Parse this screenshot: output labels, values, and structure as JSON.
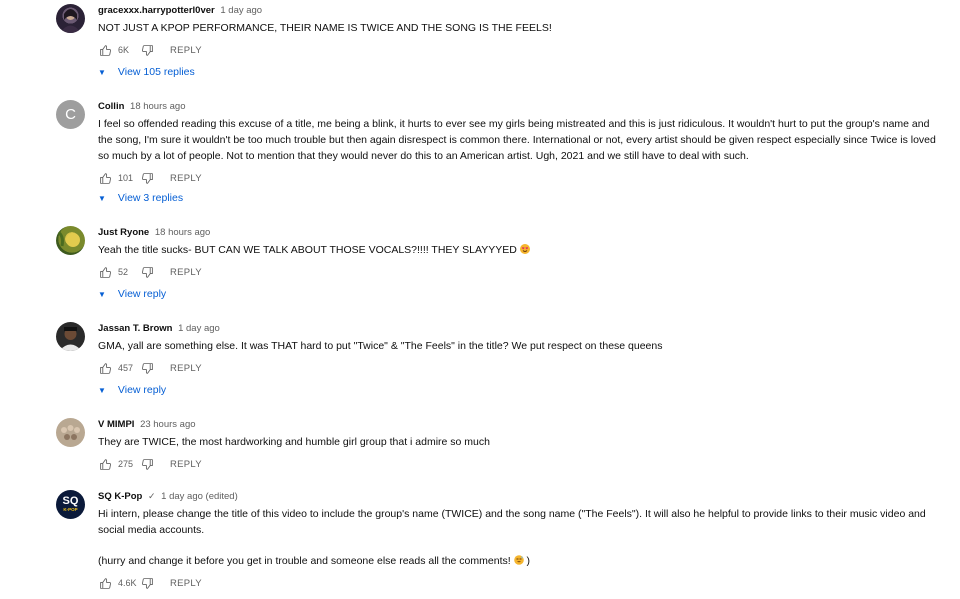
{
  "comments": [
    {
      "author": "gracexxx.harrypotterl0ver",
      "time": "1 day ago",
      "text": "NOT JUST A KPOP PERFORMANCE, THEIR NAME IS TWICE AND THE SONG IS THE FEELS!",
      "likes": "6K",
      "reply_label": "REPLY",
      "view_replies": "View 105 replies"
    },
    {
      "author": "Collin",
      "time": "18 hours ago",
      "avatar_letter": "C",
      "text": "I feel so offended reading this excuse of a title, me being a blink, it hurts to ever see my girls being mistreated and this is just ridiculous. It wouldn't hurt to put the group's name and the song, I'm sure it wouldn't be too much trouble but then again disrespect is common there. International or not, every artist should be given respect especially since Twice is loved so much by a lot of people. Not to mention that they would never do this to an American artist. Ugh, 2021 and we still have to deal with such.",
      "likes": "101",
      "reply_label": "REPLY",
      "view_replies": "View 3 replies"
    },
    {
      "author": "Just Ryone",
      "time": "18 hours ago",
      "text": "Yeah the title sucks- BUT CAN WE TALK ABOUT THOSE VOCALS?!!!! THEY SLAYYYED",
      "likes": "52",
      "reply_label": "REPLY",
      "view_replies": "View reply"
    },
    {
      "author": "Jassan T. Brown",
      "time": "1 day ago",
      "text": "GMA, yall are something else. It was THAT hard to put \"Twice\" & \"The Feels\" in the title? We put respect on these queens",
      "likes": "457",
      "reply_label": "REPLY",
      "view_replies": "View reply"
    },
    {
      "author": "V MIMPI",
      "time": "23 hours ago",
      "text": "They are TWICE, the most hardworking and humble girl group that i admire so much",
      "likes": "275",
      "reply_label": "REPLY"
    },
    {
      "author": "SQ K-Pop",
      "verified_mark": "✓",
      "time": "1 day ago (edited)",
      "avatar_text": "SQ",
      "avatar_subtext": "K-POP",
      "text": "Hi intern, please change the title of this video to include the group's name (TWICE) and the song name (\"The Feels\"). It will also he helpful to provide links to their music video and social media accounts.",
      "text2": "(hurry and change it before you get in trouble and someone else reads all the comments!",
      "text2_end": ")",
      "likes": "4.6K",
      "reply_label": "REPLY"
    }
  ],
  "icons": {
    "like": "thumb-up-icon",
    "dislike": "thumb-down-icon",
    "expand": "chevron-down-icon"
  },
  "colors": {
    "link": "#065fd4",
    "meta": "#606060",
    "text": "#0f0f0f"
  }
}
